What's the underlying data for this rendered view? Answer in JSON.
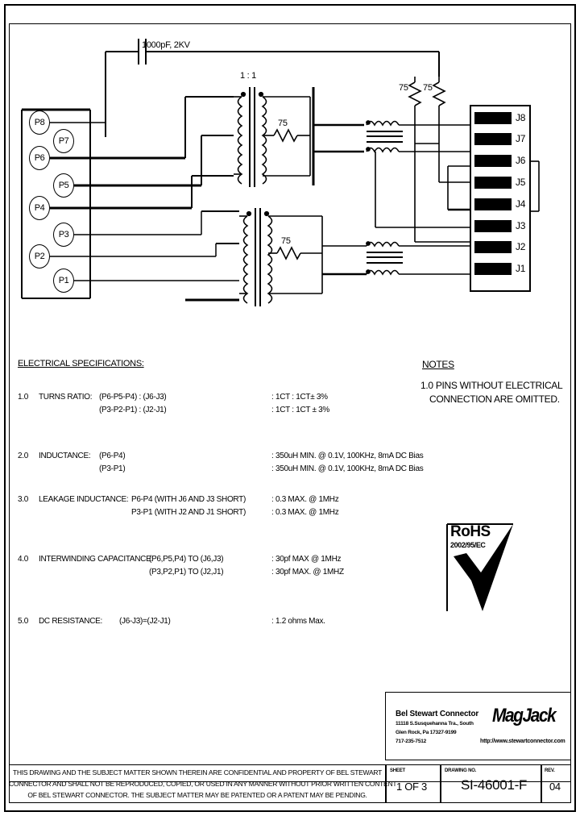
{
  "drawing": {
    "capacitor_label": "1000pF, 2KV",
    "transformer_ratio": "1 : 1",
    "resistor_75_label": "75",
    "pins_primary": [
      {
        "id": "P8",
        "label": "P8"
      },
      {
        "id": "P7",
        "label": "P7"
      },
      {
        "id": "P6",
        "label": "P6"
      },
      {
        "id": "P5",
        "label": "P5"
      },
      {
        "id": "P4",
        "label": "P4"
      },
      {
        "id": "P3",
        "label": "P3"
      },
      {
        "id": "P2",
        "label": "P2"
      },
      {
        "id": "P1",
        "label": "P1"
      }
    ],
    "pins_connector": [
      {
        "id": "J8",
        "label": "J8"
      },
      {
        "id": "J7",
        "label": "J7"
      },
      {
        "id": "J6",
        "label": "J6"
      },
      {
        "id": "J5",
        "label": "J5"
      },
      {
        "id": "J4",
        "label": "J4"
      },
      {
        "id": "J3",
        "label": "J3"
      },
      {
        "id": "J2",
        "label": "J2"
      },
      {
        "id": "J1",
        "label": "J1"
      }
    ]
  },
  "specs": {
    "heading": "ELECTRICAL SPECIFICATIONS:",
    "items": [
      {
        "number": "1.0",
        "name": "TURNS RATIO:",
        "lines": [
          {
            "left": "(P6-P5-P4) : (J6-J3)",
            "right": ": 1CT : 1CT± 3%"
          },
          {
            "left": "(P3-P2-P1) : (J2-J1)",
            "right": ": 1CT : 1CT ± 3%"
          }
        ]
      },
      {
        "number": "2.0",
        "name": "INDUCTANCE:",
        "lines": [
          {
            "left": "(P6-P4)",
            "right": ": 350uH MIN. @ 0.1V, 100KHz, 8mA DC Bias"
          },
          {
            "left": "(P3-P1)",
            "right": ": 350uH MIN. @ 0.1V, 100KHz, 8mA DC Bias"
          }
        ]
      },
      {
        "number": "3.0",
        "name": "LEAKAGE INDUCTANCE:",
        "lines": [
          {
            "left": "P6-P4 (WITH J6 AND J3 SHORT)",
            "right": ": 0.3 MAX. @ 1MHz"
          },
          {
            "left": "P3-P1 (WITH J2 AND J1 SHORT)",
            "right": ": 0.3 MAX. @ 1MHz"
          }
        ]
      },
      {
        "number": "4.0",
        "name": "INTERWINDING CAPACITANCE:",
        "lines": [
          {
            "left": "(P6,P5,P4) TO (J6,J3)",
            "right": ": 30pf MAX @ 1MHz"
          },
          {
            "left": "(P3,P2,P1) TO (J2,J1)",
            "right": ": 30pf MAX. @ 1MHZ"
          }
        ]
      },
      {
        "number": "5.0",
        "name": "DC RESISTANCE:",
        "lines": [
          {
            "left": "(J6-J3)=(J2-J1)",
            "right": ": 1.2 ohms Max."
          }
        ]
      }
    ]
  },
  "notes": {
    "heading": "NOTES",
    "line1": "1.0 PINS WITHOUT ELECTRICAL",
    "line2": "CONNECTION ARE OMITTED."
  },
  "rohs": {
    "title": "RoHS",
    "directive": "2002/95/EC"
  },
  "title_block": {
    "company": "Bel Stewart Connector",
    "address_line1": "11118 S.Susquehanna Tra., South",
    "address_line2": "Glen Rock, Pa  17327-9199",
    "address_line3": "717-235-7512",
    "brand": "MagJack",
    "website": "http://www.stewartconnector.com",
    "sheet_caption": "SHEET",
    "sheet_value": "1 OF 3",
    "drawing_caption": "DRAWING NO.",
    "drawing_value": "SI-46001-F",
    "rev_caption": "REV.",
    "rev_value": "04"
  },
  "confidentiality": {
    "line1": "THIS DRAWING AND THE SUBJECT MATTER SHOWN THEREIN ARE CONFIDENTIAL AND PROPERTY OF BEL STEWART",
    "line2": "CONNECTOR AND SHALL NOT BE REPRODUCED, COPIED, OR USED IN ANY MANNER WITHOUT PRIOR WRITTEN CONTENT",
    "line3": "OF BEL STEWART CONNECTOR.   THE SUBJECT MATTER MAY BE PATENTED OR A PATENT MAY BE PENDING."
  }
}
